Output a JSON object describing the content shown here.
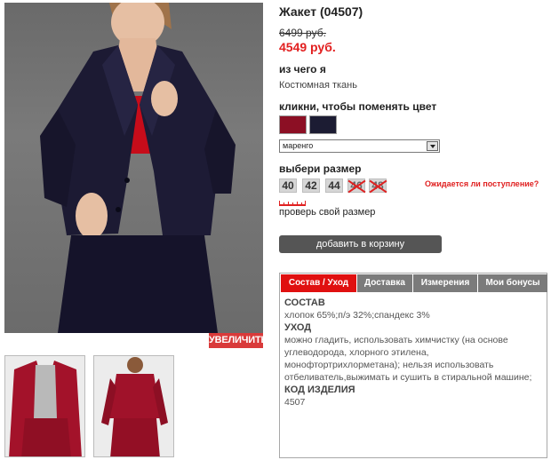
{
  "product": {
    "title": "Жакет (04507)",
    "old_price": "6499 руб.",
    "new_price": "4549 руб."
  },
  "gallery": {
    "zoom_label": "УВЕЛИЧИТЬ",
    "thumbnails": [
      "red-jacket-front",
      "red-jacket-back"
    ]
  },
  "material": {
    "heading": "из чего я",
    "value": "Костюмная ткань"
  },
  "color": {
    "heading": "кликни, чтобы поменять цвет",
    "swatches": [
      "#8c0f24",
      "#1c1c33"
    ],
    "selected": "маренго"
  },
  "size": {
    "heading": "выбери размер",
    "options": [
      {
        "label": "40",
        "available": true
      },
      {
        "label": "42",
        "available": true
      },
      {
        "label": "44",
        "available": true
      },
      {
        "label": "46",
        "available": false
      },
      {
        "label": "48",
        "available": false
      }
    ],
    "waiting_link": "Ожидается ли поступление?",
    "check_size_link": "проверь свой размер"
  },
  "cart": {
    "button_label": "добавить в корзину"
  },
  "info_tabs": {
    "tabs": [
      "Состав / Уход",
      "Доставка",
      "Измерения",
      "Мои бонусы"
    ],
    "active_index": 0,
    "composition_heading": "СОСТАВ",
    "composition_text": "хлопок 65%;п/э 32%;спандекс 3%",
    "care_heading": "УХОД",
    "care_text": "можно гладить, использовать химчистку (на основе углеводорода, хлорного этилена, монофтортрихлорметана); нельзя использовать отбеливатель,выжимать и сушить в стиральной машине;",
    "code_heading": "КОД ИЗДЕЛИЯ",
    "code_value": "4507"
  },
  "colors": {
    "price_red": "#e21f1f",
    "active_tab": "#e01010",
    "button_grey": "#555555",
    "zoom_red": "#d93a3a"
  }
}
